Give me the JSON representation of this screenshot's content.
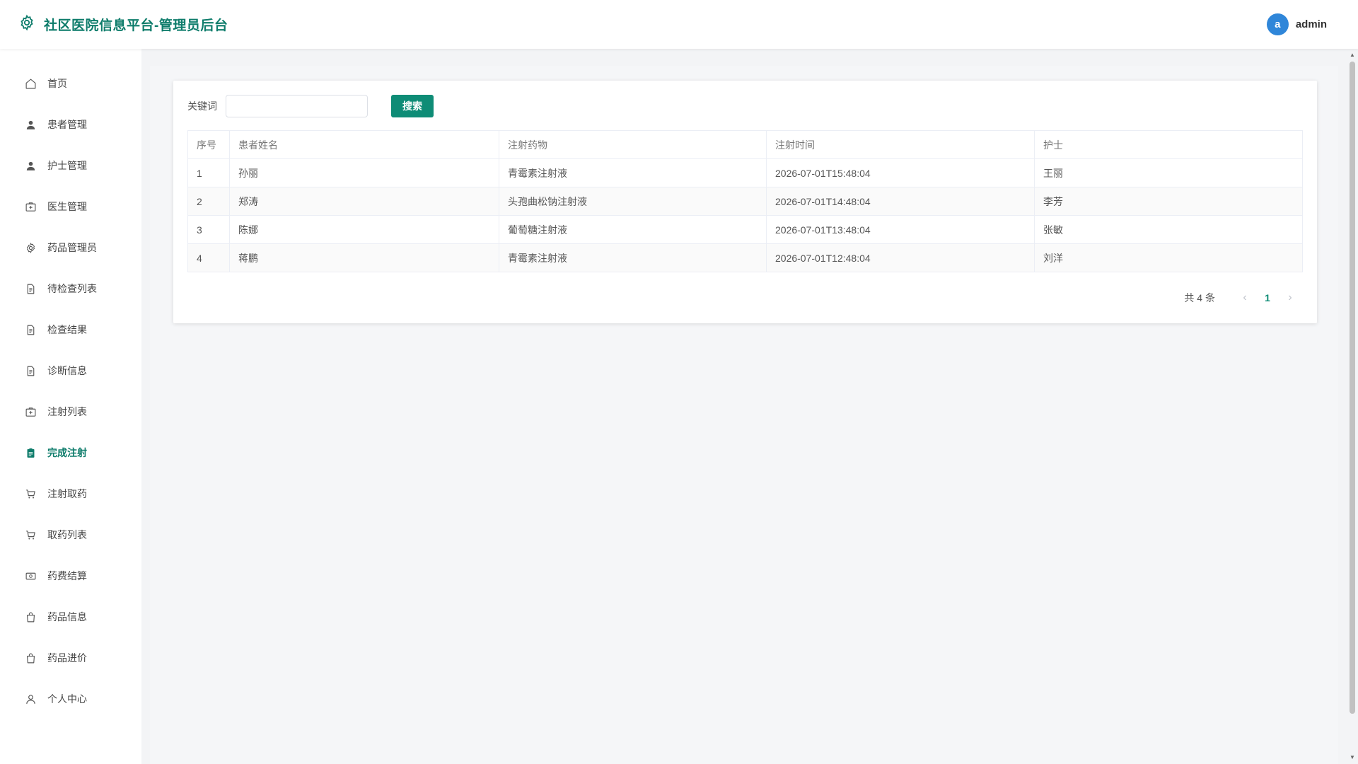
{
  "header": {
    "title": "社区医院信息平台-管理员后台",
    "avatar_letter": "a",
    "username": "admin",
    "brand_color": "#0e7c6b"
  },
  "sidebar": {
    "items": [
      {
        "label": "首页",
        "icon": "home-icon"
      },
      {
        "label": "患者管理",
        "icon": "user-icon"
      },
      {
        "label": "护士管理",
        "icon": "user-icon"
      },
      {
        "label": "医生管理",
        "icon": "medical-box-icon"
      },
      {
        "label": "药品管理员",
        "icon": "gear-icon"
      },
      {
        "label": "待检查列表",
        "icon": "document-icon"
      },
      {
        "label": "检查结果",
        "icon": "document-icon"
      },
      {
        "label": "诊断信息",
        "icon": "document-icon"
      },
      {
        "label": "注射列表",
        "icon": "medical-box-icon"
      },
      {
        "label": "完成注射",
        "icon": "clipboard-icon",
        "active": true
      },
      {
        "label": "注射取药",
        "icon": "cart-icon"
      },
      {
        "label": "取药列表",
        "icon": "cart-icon"
      },
      {
        "label": "药费结算",
        "icon": "money-icon"
      },
      {
        "label": "药品信息",
        "icon": "bag-icon"
      },
      {
        "label": "药品进价",
        "icon": "bag-icon"
      },
      {
        "label": "个人中心",
        "icon": "person-outline-icon"
      }
    ]
  },
  "search": {
    "label": "关键词",
    "value": "",
    "placeholder": "",
    "button": "搜索"
  },
  "table": {
    "headers": [
      "序号",
      "患者姓名",
      "注射药物",
      "注射时间",
      "护士"
    ],
    "rows": [
      [
        "1",
        "孙丽",
        "青霉素注射液",
        "2026-07-01T15:48:04",
        "王丽"
      ],
      [
        "2",
        "郑涛",
        "头孢曲松钠注射液",
        "2026-07-01T14:48:04",
        "李芳"
      ],
      [
        "3",
        "陈娜",
        "葡萄糖注射液",
        "2026-07-01T13:48:04",
        "张敏"
      ],
      [
        "4",
        "蒋鹏",
        "青霉素注射液",
        "2026-07-01T12:48:04",
        "刘洋"
      ]
    ]
  },
  "pagination": {
    "total": "共 4 条",
    "current": "1",
    "prev": "‹",
    "next": "›"
  }
}
